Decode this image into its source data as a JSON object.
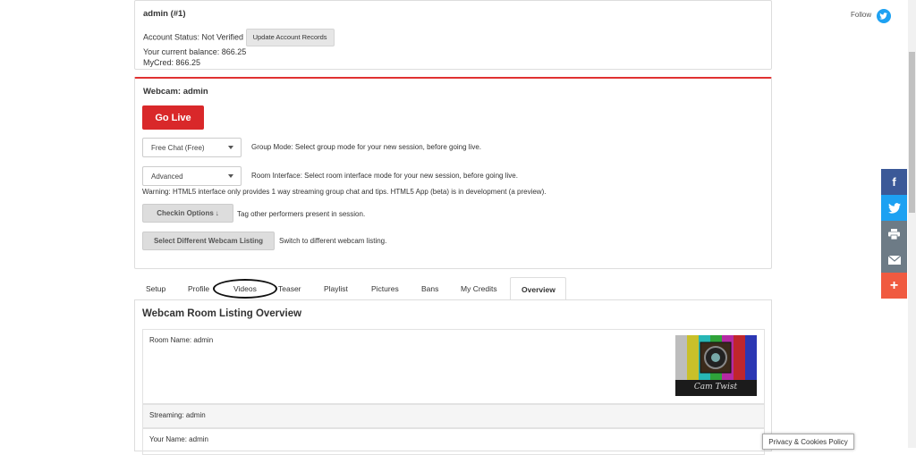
{
  "account": {
    "title": "admin (#1)",
    "status_label": "Account Status: Not Verified",
    "update_button": "Update Account Records",
    "balance": "Your current balance: 866.25",
    "mycred": "MyCred: 866.25"
  },
  "webcam": {
    "title": "Webcam: admin",
    "go_live": "Go Live",
    "group_mode_value": "Free Chat (Free)",
    "group_mode_desc": "Group Mode: Select group mode for your new session, before going live.",
    "interface_value": "Advanced",
    "interface_desc": "Room Interface: Select room interface mode for your new session, before going live.",
    "warning": "Warning: HTML5 interface only provides 1 way streaming group chat and tips. HTML5 App (beta) is in development (a preview).",
    "checkin_button": "Checkin Options",
    "checkin_arrow": "↓",
    "checkin_desc": "Tag other performers present in session.",
    "select_listing_button": "Select Different Webcam Listing",
    "select_listing_desc": "Switch to different webcam listing."
  },
  "tabs": [
    {
      "label": "Setup"
    },
    {
      "label": "Profile"
    },
    {
      "label": "Videos"
    },
    {
      "label": "Teaser"
    },
    {
      "label": "Playlist"
    },
    {
      "label": "Pictures"
    },
    {
      "label": "Bans"
    },
    {
      "label": "My Credits"
    },
    {
      "label": "Overview"
    }
  ],
  "active_tab": "Overview",
  "overview": {
    "heading": "Webcam Room Listing Overview",
    "room_name": "Room Name: admin",
    "streaming": "Streaming: admin",
    "your_name": "Your Name: admin",
    "thumb_logo_text": "Cam Twist"
  },
  "follow": {
    "label": "Follow"
  },
  "social": {
    "facebook": "f",
    "twitter": "twitter-icon",
    "print": "print-icon",
    "email": "email-icon",
    "more": "+"
  },
  "colors": {
    "accent_red": "#d9282a",
    "facebook": "#3b5998",
    "twitter": "#1da1f2",
    "print": "#6d7b86",
    "email": "#6d7b86",
    "more": "#f05a40"
  },
  "privacy": "Privacy & Cookies Policy"
}
